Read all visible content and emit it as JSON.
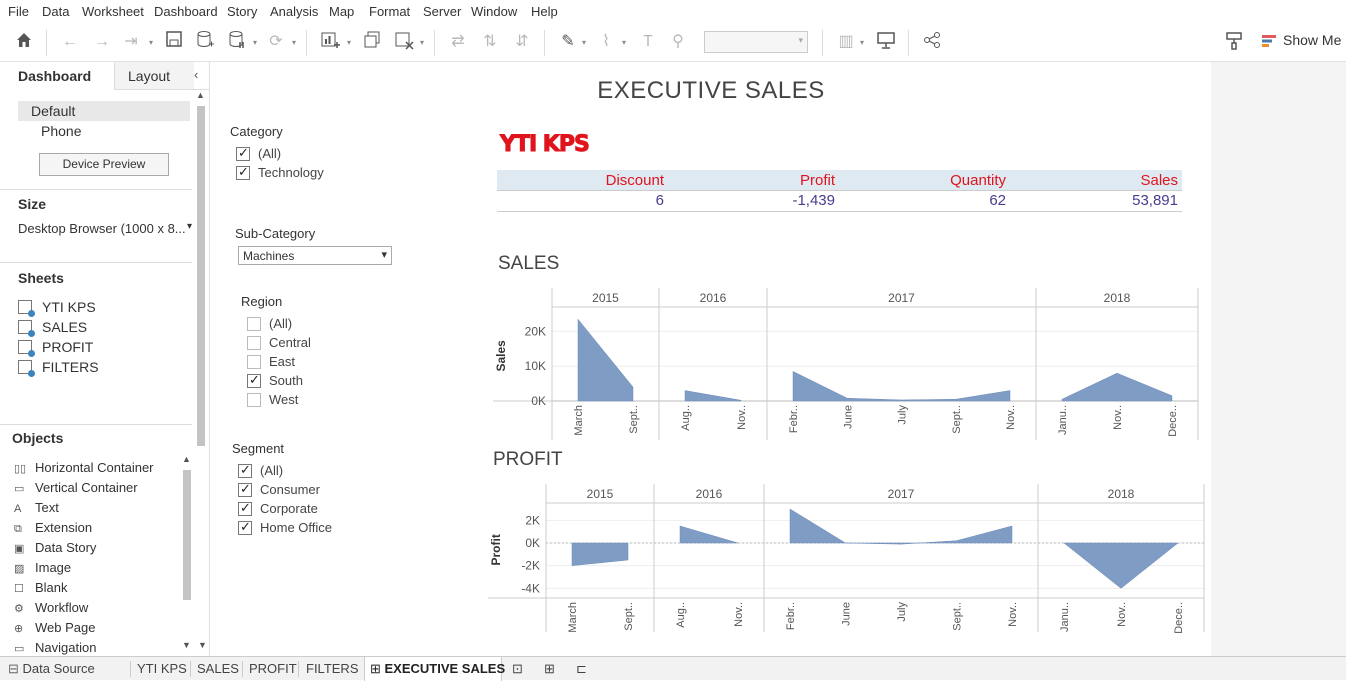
{
  "menu": [
    "File",
    "Data",
    "Worksheet",
    "Dashboard",
    "Story",
    "Analysis",
    "Map",
    "Format",
    "Server",
    "Window",
    "Help"
  ],
  "toolbar": {
    "show_me": "Show Me"
  },
  "left": {
    "tab_dashboard": "Dashboard",
    "tab_layout": "Layout",
    "devices": {
      "default": "Default",
      "phone": "Phone",
      "preview_button": "Device Preview"
    },
    "size_label": "Size",
    "size_value": "Desktop Browser (1000 x 8...",
    "sheets_label": "Sheets",
    "sheets": [
      "YTI KPS",
      "SALES",
      "PROFIT",
      "FILTERS"
    ],
    "objects_label": "Objects",
    "objects": [
      {
        "label": "Horizontal Container",
        "icon": "horizontal-container-icon"
      },
      {
        "label": "Vertical Container",
        "icon": "vertical-container-icon"
      },
      {
        "label": "Text",
        "icon": "text-icon"
      },
      {
        "label": "Extension",
        "icon": "extension-icon"
      },
      {
        "label": "Data Story",
        "icon": "data-story-icon"
      },
      {
        "label": "Image",
        "icon": "image-icon"
      },
      {
        "label": "Blank",
        "icon": "blank-icon"
      },
      {
        "label": "Workflow",
        "icon": "workflow-icon"
      },
      {
        "label": "Web Page",
        "icon": "web-page-icon"
      },
      {
        "label": "Navigation",
        "icon": "navigation-icon"
      }
    ]
  },
  "dashboard": {
    "title": "EXECUTIVE SALES",
    "filters": {
      "category": {
        "title": "Category",
        "items": [
          {
            "label": "(All)",
            "checked": true
          },
          {
            "label": "Technology",
            "checked": true
          }
        ]
      },
      "subcategory": {
        "title": "Sub-Category",
        "value": "Machines"
      },
      "region": {
        "title": "Region",
        "items": [
          {
            "label": "(All)",
            "checked": false
          },
          {
            "label": "Central",
            "checked": false
          },
          {
            "label": "East",
            "checked": false
          },
          {
            "label": "South",
            "checked": true
          },
          {
            "label": "West",
            "checked": false
          }
        ]
      },
      "segment": {
        "title": "Segment",
        "items": [
          {
            "label": "(All)",
            "checked": true
          },
          {
            "label": "Consumer",
            "checked": true
          },
          {
            "label": "Corporate",
            "checked": true
          },
          {
            "label": "Home Office",
            "checked": true
          }
        ]
      }
    },
    "kpi": {
      "title": "YTI KPS",
      "headers": [
        "Discount",
        "Profit",
        "Quantity",
        "Sales"
      ],
      "values": [
        "6",
        "-1,439",
        "62",
        "53,891"
      ]
    },
    "colors": {
      "area": "#7f9dc4",
      "kpi_header": "#e0141d",
      "kpi_value": "#4a3b8f"
    }
  },
  "chart_data": [
    {
      "type": "area",
      "title": "SALES",
      "ylabel": "Sales",
      "ylim": [
        0,
        25000
      ],
      "yticks": [
        "20K",
        "10K",
        "0K"
      ],
      "panels": [
        {
          "year": "2015",
          "months": [
            "March",
            "Sept.."
          ],
          "values": [
            23500,
            4000
          ]
        },
        {
          "year": "2016",
          "months": [
            "Aug..",
            "Nov.."
          ],
          "values": [
            3000,
            200
          ]
        },
        {
          "year": "2017",
          "months": [
            "Febr..",
            "June",
            "July",
            "Sept..",
            "Nov.."
          ],
          "values": [
            8500,
            800,
            300,
            500,
            3000
          ]
        },
        {
          "year": "2018",
          "months": [
            "Janu..",
            "Nov..",
            "Dece.."
          ],
          "values": [
            500,
            8000,
            1500
          ]
        }
      ]
    },
    {
      "type": "area",
      "title": "PROFIT",
      "ylabel": "Profit",
      "ylim": [
        -4500,
        3000
      ],
      "yticks": [
        "2K",
        "0K",
        "-2K",
        "-4K"
      ],
      "panels": [
        {
          "year": "2015",
          "months": [
            "March",
            "Sept.."
          ],
          "values": [
            -2000,
            -1500
          ]
        },
        {
          "year": "2016",
          "months": [
            "Aug..",
            "Nov.."
          ],
          "values": [
            1500,
            0
          ]
        },
        {
          "year": "2017",
          "months": [
            "Febr..",
            "June",
            "July",
            "Sept..",
            "Nov.."
          ],
          "values": [
            3000,
            0,
            -100,
            200,
            1500
          ]
        },
        {
          "year": "2018",
          "months": [
            "Janu..",
            "Nov..",
            "Dece.."
          ],
          "values": [
            0,
            -4000,
            0
          ]
        }
      ]
    }
  ],
  "footer": {
    "data_source": "Data Source",
    "tabs": [
      "YTI KPS",
      "SALES",
      "PROFIT",
      "FILTERS"
    ],
    "active_tab": "EXECUTIVE SALES"
  }
}
